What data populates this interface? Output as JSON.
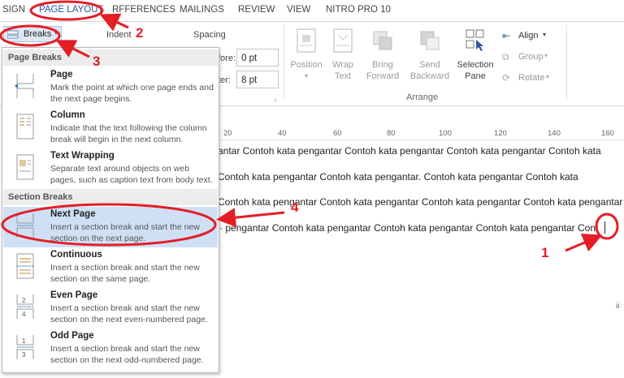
{
  "tabs": [
    "SIGN",
    "PAGE LAYOUT",
    "RFFERENCES",
    "MAILINGS",
    "REVIEW",
    "VIEW",
    "NITRO PRO 10"
  ],
  "ribbon": {
    "breaks_label": "Breaks",
    "indent_label": "Indent",
    "spacing_label": "Spacing",
    "before_label": "fore:",
    "before_value": "0 pt",
    "after_label": "ter:",
    "after_value": "8 pt",
    "position_label": "Position",
    "wrap_text_label": "Wrap\nText",
    "bring_forward_label": "Bring\nForward",
    "send_backward_label": "Send\nBackward",
    "selection_pane_label": "Selection\nPane",
    "align_label": "Align",
    "group_label": "Group",
    "rotate_label": "Rotate",
    "arrange_group_label": "Arrange"
  },
  "menu": {
    "page_breaks_header": "Page Breaks",
    "section_breaks_header": "Section Breaks",
    "items": [
      {
        "title": "Page",
        "desc": "Mark the point at which one page ends and the next page begins."
      },
      {
        "title": "Column",
        "desc": "Indicate that the text following the column break will begin in the next column."
      },
      {
        "title": "Text Wrapping",
        "desc": "Separate text around objects on web pages, such as caption text from body text."
      },
      {
        "title": "Next Page",
        "desc": "Insert a section break and start the new section on the next page."
      },
      {
        "title": "Continuous",
        "desc": "Insert a section break and start the new section on the same page."
      },
      {
        "title": "Even Page",
        "desc": "Insert a section break and start the new section on the next even-numbered page."
      },
      {
        "title": "Odd Page",
        "desc": "Insert a section break and start the new section on the next odd-numbered page."
      }
    ]
  },
  "ruler": [
    "20",
    "40",
    "60",
    "80",
    "100",
    "120",
    "140",
    "160"
  ],
  "document": {
    "lines": [
      "antar Contoh kata pengantar Contoh kata pengantar Contoh kata pengantar Contoh kata",
      " Contoh kata pengantar Contoh kata pengantar. Contoh kata pengantar Contoh kata",
      " Contoh kata pengantar Contoh kata pengantar Contoh kata pengantar Contoh kata pengantar",
      "· pengantar Contoh kata pengantar Contoh kata pengantar Contoh kata pengantar Cont",
      "ii"
    ]
  },
  "annotations": [
    "1",
    "2",
    "3",
    "4"
  ],
  "colors": {
    "accent": "#2b579a",
    "annotation": "#e41e25",
    "highlight": "#cfe0f5"
  }
}
